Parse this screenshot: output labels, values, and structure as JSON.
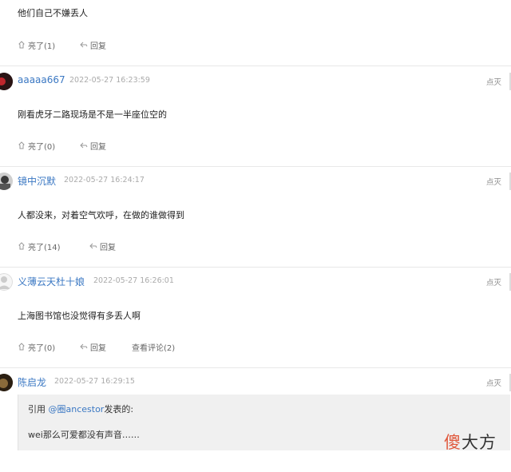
{
  "comments": [
    {
      "text": "他们自己不嫌丢人",
      "like_label": "亮了(1)",
      "reply_label": "回复"
    },
    {
      "username": "aaaaa667",
      "time": "2022-05-27 16:23:59",
      "report_label": "点灭",
      "text": "刚看虎牙二路现场是不是一半座位空的",
      "like_label": "亮了(0)",
      "reply_label": "回复"
    },
    {
      "username": "镜中沉默",
      "time": "2022-05-27 16:24:17",
      "report_label": "点灭",
      "text": "人都没来，对着空气欢呼，在做的谁做得到",
      "like_label": "亮了(14)",
      "reply_label": "回复"
    },
    {
      "username": "义薄云天杜十娘",
      "time": "2022-05-27 16:26:01",
      "report_label": "点灭",
      "text": "上海图书馆也没觉得有多丢人啊",
      "like_label": "亮了(0)",
      "reply_label": "回复",
      "view_replies_label": "查看评论(2)"
    },
    {
      "username": "陈启龙",
      "time": "2022-05-27 16:29:15",
      "report_label": "点灭",
      "quote": {
        "prefix": "引用 ",
        "mention": "@圈ancestor",
        "suffix": "发表的:",
        "text": "wei那么可爱都没有声音……"
      }
    }
  ],
  "watermark": {
    "char1": "傻",
    "rest": "大方"
  },
  "colors": {
    "username": "#3b78c3",
    "divider": "#e8e8e8",
    "quote_bg": "#f0f0f0"
  }
}
